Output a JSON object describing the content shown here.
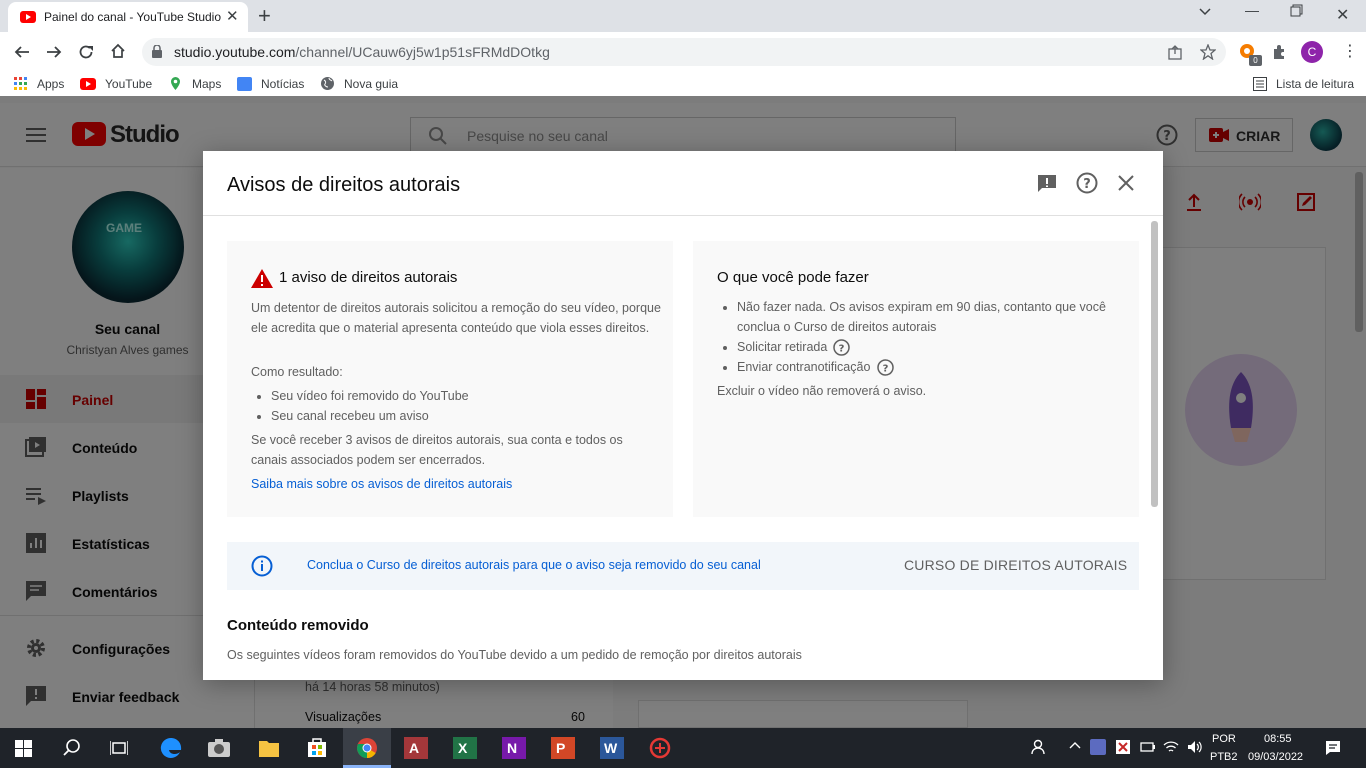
{
  "browser": {
    "tab_title": "Painel do canal - YouTube Studio",
    "url_host": "studio.youtube.com",
    "url_path": "/channel/UCauw6yj5w1p51sFRMdDOtkg",
    "bookmarks": [
      "Apps",
      "YouTube",
      "Maps",
      "Notícias",
      "Nova guia"
    ],
    "reading_list": "Lista de leitura",
    "profile_initial": "C",
    "extension_badge": "0"
  },
  "studio": {
    "logo_text": "Studio",
    "search_placeholder": "Pesquise no seu canal",
    "create_label": "CRIAR",
    "channel_label": "Seu canal",
    "channel_name": "Christyan Alves games",
    "avatar_text": "GAME",
    "nav": [
      "Painel",
      "Conteúdo",
      "Playlists",
      "Estatísticas",
      "Comentários",
      "Configurações",
      "Enviar feedback"
    ],
    "bg_partial_text": "há 14 horas 58 minutos)",
    "bg_views_label": "Visualizações",
    "bg_views_value": "60"
  },
  "modal": {
    "title": "Avisos de direitos autorais",
    "left_card": {
      "heading": "1 aviso de direitos autorais",
      "paragraph": "Um detentor de direitos autorais solicitou a remoção do seu vídeo, porque ele acredita que o material apresenta conteúdo que viola esses direitos.",
      "result_label": "Como resultado:",
      "results": [
        "Seu vídeo foi removido do YouTube",
        "Seu canal recebeu um aviso"
      ],
      "warning": "Se você receber 3 avisos de direitos autorais, sua conta e todos os canais associados podem ser encerrados.",
      "link": "Saiba mais sobre os avisos de direitos autorais"
    },
    "right_card": {
      "heading": "O que você pode fazer",
      "options": [
        "Não fazer nada. Os avisos expiram em 90 dias, contanto que você conclua o Curso de direitos autorais",
        "Solicitar retirada",
        "Enviar contranotificação"
      ],
      "note": "Excluir o vídeo não removerá o aviso."
    },
    "banner": {
      "text": "Conclua o Curso de direitos autorais para que o aviso seja removido do seu canal",
      "button": "CURSO DE DIREITOS AUTORAIS"
    },
    "removed": {
      "title": "Conteúdo removido",
      "description": "Os seguintes vídeos foram removidos do YouTube devido a um pedido de remoção por direitos autorais"
    }
  },
  "taskbar": {
    "language": "POR",
    "layout": "PTB2",
    "time": "08:55",
    "date": "09/03/2022"
  },
  "colors": {
    "youtube_red": "#ff0000",
    "link_blue": "#065fd4",
    "warning_red": "#cc0000",
    "taskbar_bg": "#1f2329"
  }
}
